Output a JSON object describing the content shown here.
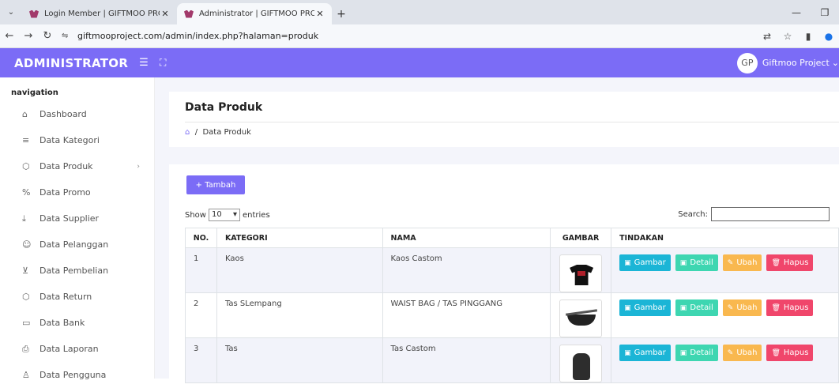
{
  "browser": {
    "tabs": [
      {
        "label": "Login Member | GIFTMOO PRO",
        "active": false
      },
      {
        "label": "Administrator | GIFTMOO PRO",
        "active": true
      }
    ],
    "url": "giftmooproject.com/admin/index.php?halaman=produk"
  },
  "topnav": {
    "brand": "ADMINISTRATOR",
    "user_name": "Giftmoo Project",
    "avatar_text": "GP",
    "colors": {
      "accent": "#7b6cf6"
    }
  },
  "sidebar": {
    "title": "navigation",
    "items": [
      {
        "label": "Dashboard",
        "icon": "home-icon"
      },
      {
        "label": "Data Kategori",
        "icon": "list-icon"
      },
      {
        "label": "Data Produk",
        "icon": "box-icon"
      },
      {
        "label": "Data Promo",
        "icon": "percent-icon"
      },
      {
        "label": "Data Supplier",
        "icon": "download-icon"
      },
      {
        "label": "Data Pelanggan",
        "icon": "users-icon"
      },
      {
        "label": "Data Pembelian",
        "icon": "cart-icon"
      },
      {
        "label": "Data Return",
        "icon": "box-icon"
      },
      {
        "label": "Data Bank",
        "icon": "card-icon"
      },
      {
        "label": "Data Laporan",
        "icon": "printer-icon"
      },
      {
        "label": "Data Pengguna",
        "icon": "user-icon"
      }
    ]
  },
  "page": {
    "title": "Data Produk",
    "breadcrumb": "Data Produk"
  },
  "table_controls": {
    "add_label": "+ Tambah",
    "show_label": "Show",
    "entries_value": "10",
    "entries_label": "entries",
    "search_label": "Search:"
  },
  "table": {
    "headers": [
      "NO.",
      "KATEGORI",
      "NAMA",
      "GAMBAR",
      "TINDAKAN"
    ],
    "rows": [
      {
        "no": "1",
        "kategori": "Kaos",
        "nama": "Kaos Castom",
        "image": "tshirt-image"
      },
      {
        "no": "2",
        "kategori": "Tas SLempang",
        "nama": "WAIST BAG / TAS PINGGANG",
        "image": "waistbag-image"
      },
      {
        "no": "3",
        "kategori": "Tas",
        "nama": "Tas Castom",
        "image": "backpack-image"
      }
    ],
    "actions": {
      "gambar": "Gambar",
      "detail": "Detail",
      "ubah": "Ubah",
      "hapus": "Hapus"
    }
  }
}
